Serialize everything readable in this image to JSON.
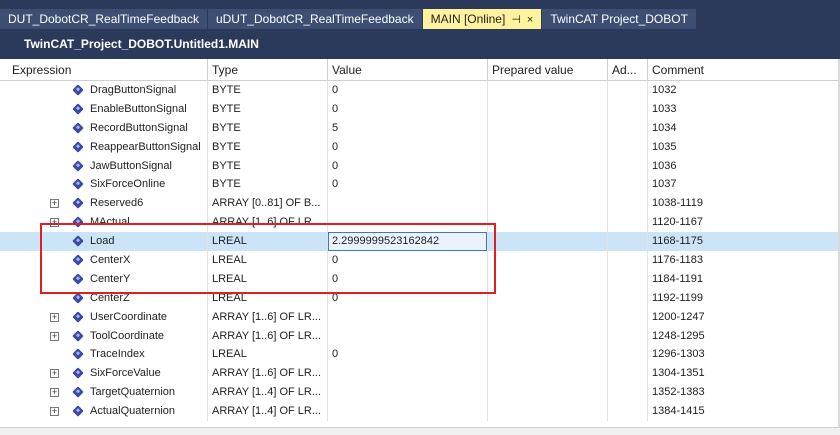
{
  "tabs": [
    {
      "label": "DUT_DobotCR_RealTimeFeedback"
    },
    {
      "label": "uDUT_DobotCR_RealTimeFeedback"
    },
    {
      "label": "MAIN [Online]",
      "pin": "⊣",
      "close": "×"
    },
    {
      "label": "TwinCAT Project_DOBOT"
    }
  ],
  "path_title": "TwinCAT_Project_DOBOT.Untitled1.MAIN",
  "columns": {
    "expression": "Expression",
    "type": "Type",
    "value": "Value",
    "prepared": "Prepared value",
    "address": "Ad...",
    "comment": "Comment"
  },
  "rows": [
    {
      "name": "DragButtonSignal",
      "type": "BYTE",
      "value": "0",
      "comment": "1032"
    },
    {
      "name": "EnableButtonSignal",
      "type": "BYTE",
      "value": "0",
      "comment": "1033"
    },
    {
      "name": "RecordButtonSignal",
      "type": "BYTE",
      "value": "5",
      "comment": "1034"
    },
    {
      "name": "ReappearButtonSignal",
      "type": "BYTE",
      "value": "0",
      "comment": "1035"
    },
    {
      "name": "JawButtonSignal",
      "type": "BYTE",
      "value": "0",
      "comment": "1036"
    },
    {
      "name": "SixForceOnline",
      "type": "BYTE",
      "value": "0",
      "comment": "1037"
    },
    {
      "name": "Reserved6",
      "type": "ARRAY [0..81] OF B...",
      "value": "",
      "comment": "1038-1119",
      "expandable": true
    },
    {
      "name": "MActual",
      "type": "ARRAY [1..6] OF LR...",
      "value": "",
      "comment": "1120-1167",
      "expandable": true
    },
    {
      "name": "Load",
      "type": "LREAL",
      "value": "2.2999999523162842",
      "comment": "1168-1175",
      "selected": true
    },
    {
      "name": "CenterX",
      "type": "LREAL",
      "value": "0",
      "comment": "1176-1183"
    },
    {
      "name": "CenterY",
      "type": "LREAL",
      "value": "0",
      "comment": "1184-1191"
    },
    {
      "name": "CenterZ",
      "type": "LREAL",
      "value": "0",
      "comment": "1192-1199"
    },
    {
      "name": "UserCoordinate",
      "type": "ARRAY [1..6] OF LR...",
      "value": "",
      "comment": "1200-1247",
      "expandable": true
    },
    {
      "name": "ToolCoordinate",
      "type": "ARRAY [1..6] OF LR...",
      "value": "",
      "comment": "1248-1295",
      "expandable": true
    },
    {
      "name": "TraceIndex",
      "type": "LREAL",
      "value": "0",
      "comment": "1296-1303"
    },
    {
      "name": "SixForceValue",
      "type": "ARRAY [1..6] OF LR...",
      "value": "",
      "comment": "1304-1351",
      "expandable": true
    },
    {
      "name": "TargetQuaternion",
      "type": "ARRAY [1..4] OF LR...",
      "value": "",
      "comment": "1352-1383",
      "expandable": true
    },
    {
      "name": "ActualQuaternion",
      "type": "ARRAY [1..4] OF LR...",
      "value": "",
      "comment": "1384-1415",
      "expandable": true
    }
  ],
  "colors": {
    "tabbar_bg": "#2b3a5a",
    "active_tab_bg": "#fff29d",
    "selected_row_bg": "#cce4f7",
    "highlight_border": "#e02020"
  }
}
